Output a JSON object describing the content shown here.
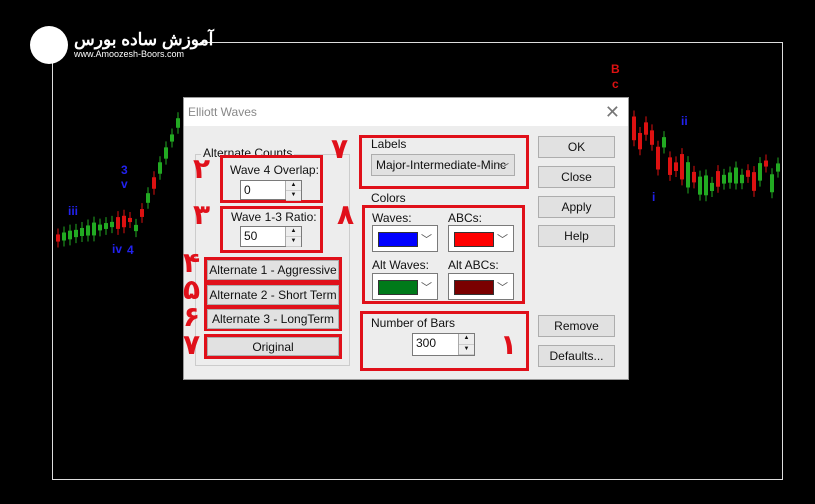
{
  "logo": {
    "name": "آموزش ساده بورس",
    "url": "www.Amoozesh-Boors.com"
  },
  "chart": {
    "wave_labels_left": [
      "iii",
      "3",
      "v",
      "iv",
      "4"
    ],
    "wave_labels_right": [
      "B",
      "c",
      "ii",
      "i"
    ],
    "colors": {
      "bull": "#22aa22",
      "bear": "#dd1111",
      "wave": "#2222ee",
      "abc": "#dd1111"
    }
  },
  "dialog": {
    "title": "Elliott Waves",
    "alternate_counts": {
      "label": "Alternate Counts",
      "wave4_label": "Wave 4 Overlap:",
      "wave4_value": "0",
      "ratio_label": "Wave 1-3 Ratio:",
      "ratio_value": "50",
      "buttons": [
        "Alternate 1 - Aggressive",
        "Alternate 2 - Short Term",
        "Alternate 3 - LongTerm",
        "Original"
      ]
    },
    "labels": {
      "label": "Labels",
      "selected": "Major-Intermediate-Minc"
    },
    "colors": {
      "label": "Colors",
      "waves": "Waves:",
      "abcs": "ABCs:",
      "alt_waves": "Alt Waves:",
      "alt_abcs": "Alt ABCs:",
      "waves_color": "#0000ff",
      "abcs_color": "#ff0000",
      "alt_waves_color": "#007a1a",
      "alt_abcs_color": "#7a0000"
    },
    "bars": {
      "label": "Number of Bars",
      "value": "300"
    },
    "buttons": {
      "ok": "OK",
      "close": "Close",
      "apply": "Apply",
      "help": "Help",
      "remove": "Remove",
      "defaults": "Defaults..."
    }
  },
  "annotations": {
    "n1": "۱",
    "n2": "۲",
    "n3": "۳",
    "n4": "۴",
    "n5": "۵",
    "n6": "۶",
    "n7a": "۷",
    "n7b": "۷",
    "n8": "۸"
  }
}
